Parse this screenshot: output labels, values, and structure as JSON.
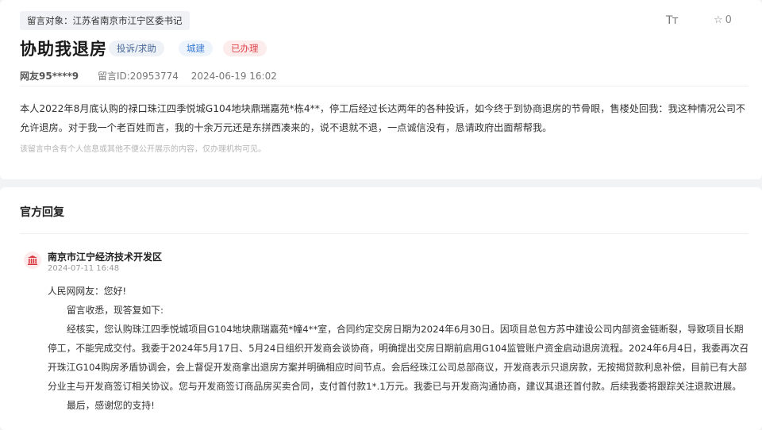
{
  "message": {
    "target": "留言对象：江苏省南京市江宁区委书记",
    "font_size_icon": "Tт",
    "star_icon": "☆",
    "star_count": "0",
    "title": "协助我退房",
    "tags": {
      "type": "投诉/求助",
      "field": "城建",
      "status": "已办理"
    },
    "user": "网友95****9",
    "message_id": "留言ID:20953774",
    "datetime": "2024-06-19 16:02",
    "content": "本人2022年8月底认购的禄口珠江四季悦城G104地块鼎瑞嘉苑*栋4**，停工后经过长达两年的各种投诉，如今终于到协商退房的节骨眼，售楼处回我：我这种情况公司不允许退房。对于我一个老百姓而言，我的十余万元还是东拼西凑来的，说不退就不退，一点诚信没有，恳请政府出面帮帮我。",
    "privacy_notice": "该留言中含有个人信息或其他不便公开展示的内容，仅办理机构可见。"
  },
  "reply": {
    "heading": "官方回复",
    "org_name": "南京市江宁经济技术开发区",
    "org_date": "2024-07-11 16:48",
    "paragraphs": [
      "人民网网友：您好!",
      "留言收悉，现答复如下:",
      "经核实，您认购珠江四季悦城项目G104地块鼎瑞嘉苑*幢4**室，合同约定交房日期为2024年6月30日。因项目总包方苏中建设公司内部资金链断裂，导致项目长期停工，不能完成交付。我委于2024年5月17日、5月24日组织开发商会谈协商，明确提出交房日期前启用G104监管账户资金启动退房流程。2024年6月4日，我委再次召开珠江G104购房矛盾协调会，会上督促开发商拿出退房方案并明确相应时间节点。会后经珠江公司总部商议，开发商表示只退房款，无按揭贷款利息补偿，目前已有大部分业主与开发商签订相关协议。您与开发商签订商品房买卖合同，支付首付款1*.1万元。我委已与开发商沟通协商，建议其退还首付款。后续我委将跟踪关注退款进展。",
      "最后，感谢您的支持!"
    ]
  },
  "colors": {
    "accent_red": "#e0434a",
    "accent_blue": "#3a7bd5",
    "icon_red": "#d9363e"
  }
}
